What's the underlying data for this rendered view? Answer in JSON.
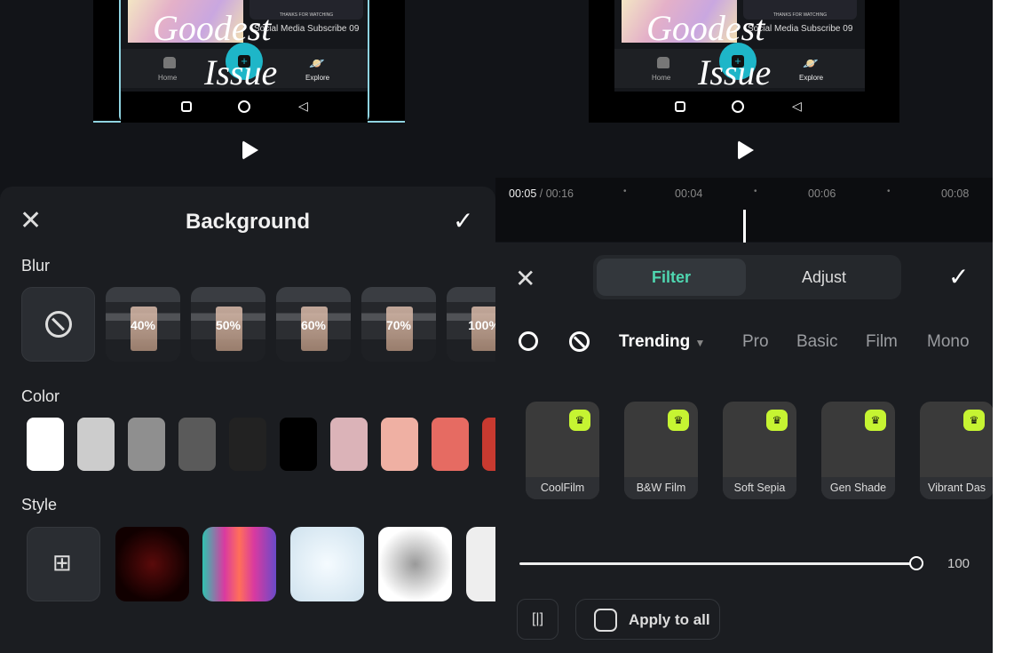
{
  "left_preview": {
    "video_overlay_text": [
      "Goodest",
      "Issue"
    ],
    "card_caption": "THANKS FOR WATCHING",
    "subtitle": "Social Media Subscribe 09",
    "nav": [
      "Home",
      "Explore"
    ]
  },
  "right_preview": {
    "video_overlay_text": [
      "Goodest",
      "Issue"
    ],
    "card_caption": "THANKS FOR WATCHING",
    "subtitle": "Social Media Subscribe 09",
    "nav": [
      "Home",
      "Explore"
    ]
  },
  "background_panel": {
    "title": "Background",
    "blur_label": "Blur",
    "blur_options": [
      "40%",
      "50%",
      "60%",
      "70%",
      "100%"
    ],
    "color_label": "Color",
    "colors": [
      "#ffffff",
      "#cccccc",
      "#8f8f8f",
      "#5a5a5a",
      "#222222",
      "#000000",
      "#dbb3b8",
      "#efb0a3",
      "#e66b62",
      "#c83a30"
    ],
    "style_label": "Style"
  },
  "timeline": {
    "current": "00:05",
    "total": "/ 00:16",
    "ticks": [
      "00:04",
      "00:06",
      "00:08"
    ]
  },
  "filter_panel": {
    "tabs": [
      "Filter",
      "Adjust"
    ],
    "active_tab": "Filter",
    "accent": "#4fd6b0",
    "categories": [
      "Trending",
      "Pro",
      "Basic",
      "Film",
      "Mono"
    ],
    "filters": [
      "CoolFilm",
      "B&W Film",
      "Soft Sepia",
      "Gen Shade",
      "Vibrant Das"
    ],
    "intensity": 100,
    "intensity_label": "100",
    "apply_all": "Apply to all"
  }
}
